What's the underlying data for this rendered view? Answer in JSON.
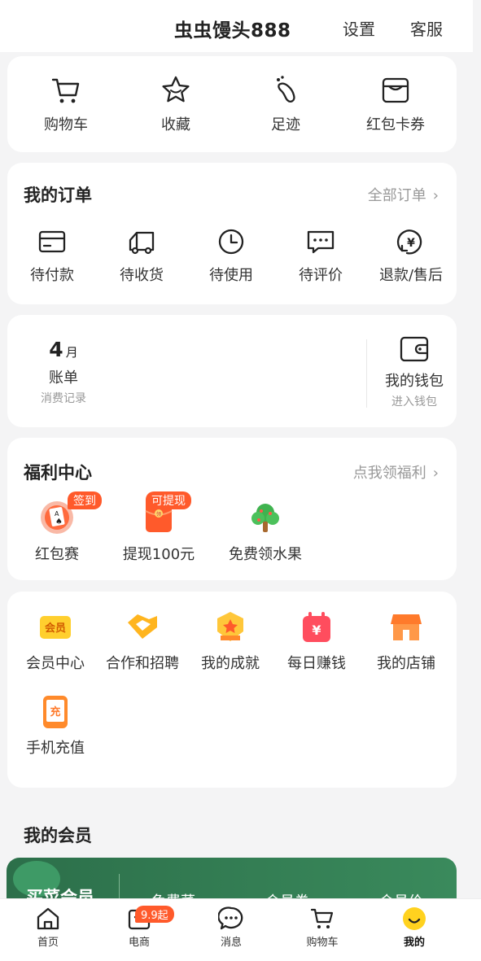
{
  "header": {
    "username": "虫虫馒头888",
    "settings_label": "设置",
    "service_label": "客服"
  },
  "quick": [
    {
      "label": "购物车",
      "icon": "cart-icon"
    },
    {
      "label": "收藏",
      "icon": "star-icon"
    },
    {
      "label": "足迹",
      "icon": "footprint-icon"
    },
    {
      "label": "红包卡券",
      "icon": "coupon-icon"
    }
  ],
  "orders": {
    "title": "我的订单",
    "all_label": "全部订单",
    "items": [
      {
        "label": "待付款",
        "icon": "card-icon"
      },
      {
        "label": "待收货",
        "icon": "truck-icon"
      },
      {
        "label": "待使用",
        "icon": "clock-icon"
      },
      {
        "label": "待评价",
        "icon": "comment-icon"
      },
      {
        "label": "退款/售后",
        "icon": "refund-icon"
      }
    ]
  },
  "bill": {
    "month_num": "4",
    "month_unit": "月",
    "label": "账单",
    "sub": "消费记录",
    "wallet_label": "我的钱包",
    "wallet_sub": "进入钱包"
  },
  "welfare": {
    "title": "福利中心",
    "link": "点我领福利",
    "items": [
      {
        "label": "红包赛",
        "badge": "签到",
        "icon": "poker-icon"
      },
      {
        "label": "提现100元",
        "badge": "可提现",
        "icon": "red-envelope-icon"
      },
      {
        "label": "免费领水果",
        "badge": "",
        "icon": "tree-icon"
      }
    ]
  },
  "services": {
    "items": [
      {
        "label": "会员中心",
        "icon": "vip-icon",
        "icon_text": "会员"
      },
      {
        "label": "合作和招聘",
        "icon": "handshake-icon",
        "icon_text": ""
      },
      {
        "label": "我的成就",
        "icon": "medal-icon",
        "icon_text": ""
      },
      {
        "label": "每日赚钱",
        "icon": "money-calendar-icon",
        "icon_text": "¥"
      },
      {
        "label": "我的店铺",
        "icon": "shop-icon",
        "icon_text": ""
      },
      {
        "label": "手机充值",
        "icon": "phone-recharge-icon",
        "icon_text": "充"
      }
    ]
  },
  "member": {
    "title": "我的会员",
    "banner_label": "买菜会员",
    "banner_col1": "免费菜",
    "banner_col2": "会员券",
    "banner_col3": "会员价"
  },
  "nav": {
    "active": "我的",
    "items": [
      {
        "label": "首页",
        "icon": "home-icon",
        "badge": ""
      },
      {
        "label": "电商",
        "icon": "shopping-bag-icon",
        "badge": "9.9起"
      },
      {
        "label": "消息",
        "icon": "message-icon",
        "badge": ""
      },
      {
        "label": "购物车",
        "icon": "cart-icon",
        "badge": ""
      },
      {
        "label": "我的",
        "icon": "smile-icon",
        "badge": ""
      }
    ]
  },
  "colors": {
    "accent": "#ff5a2b",
    "brand_yellow": "#ffd21f",
    "member_green": "#2f7b52"
  }
}
